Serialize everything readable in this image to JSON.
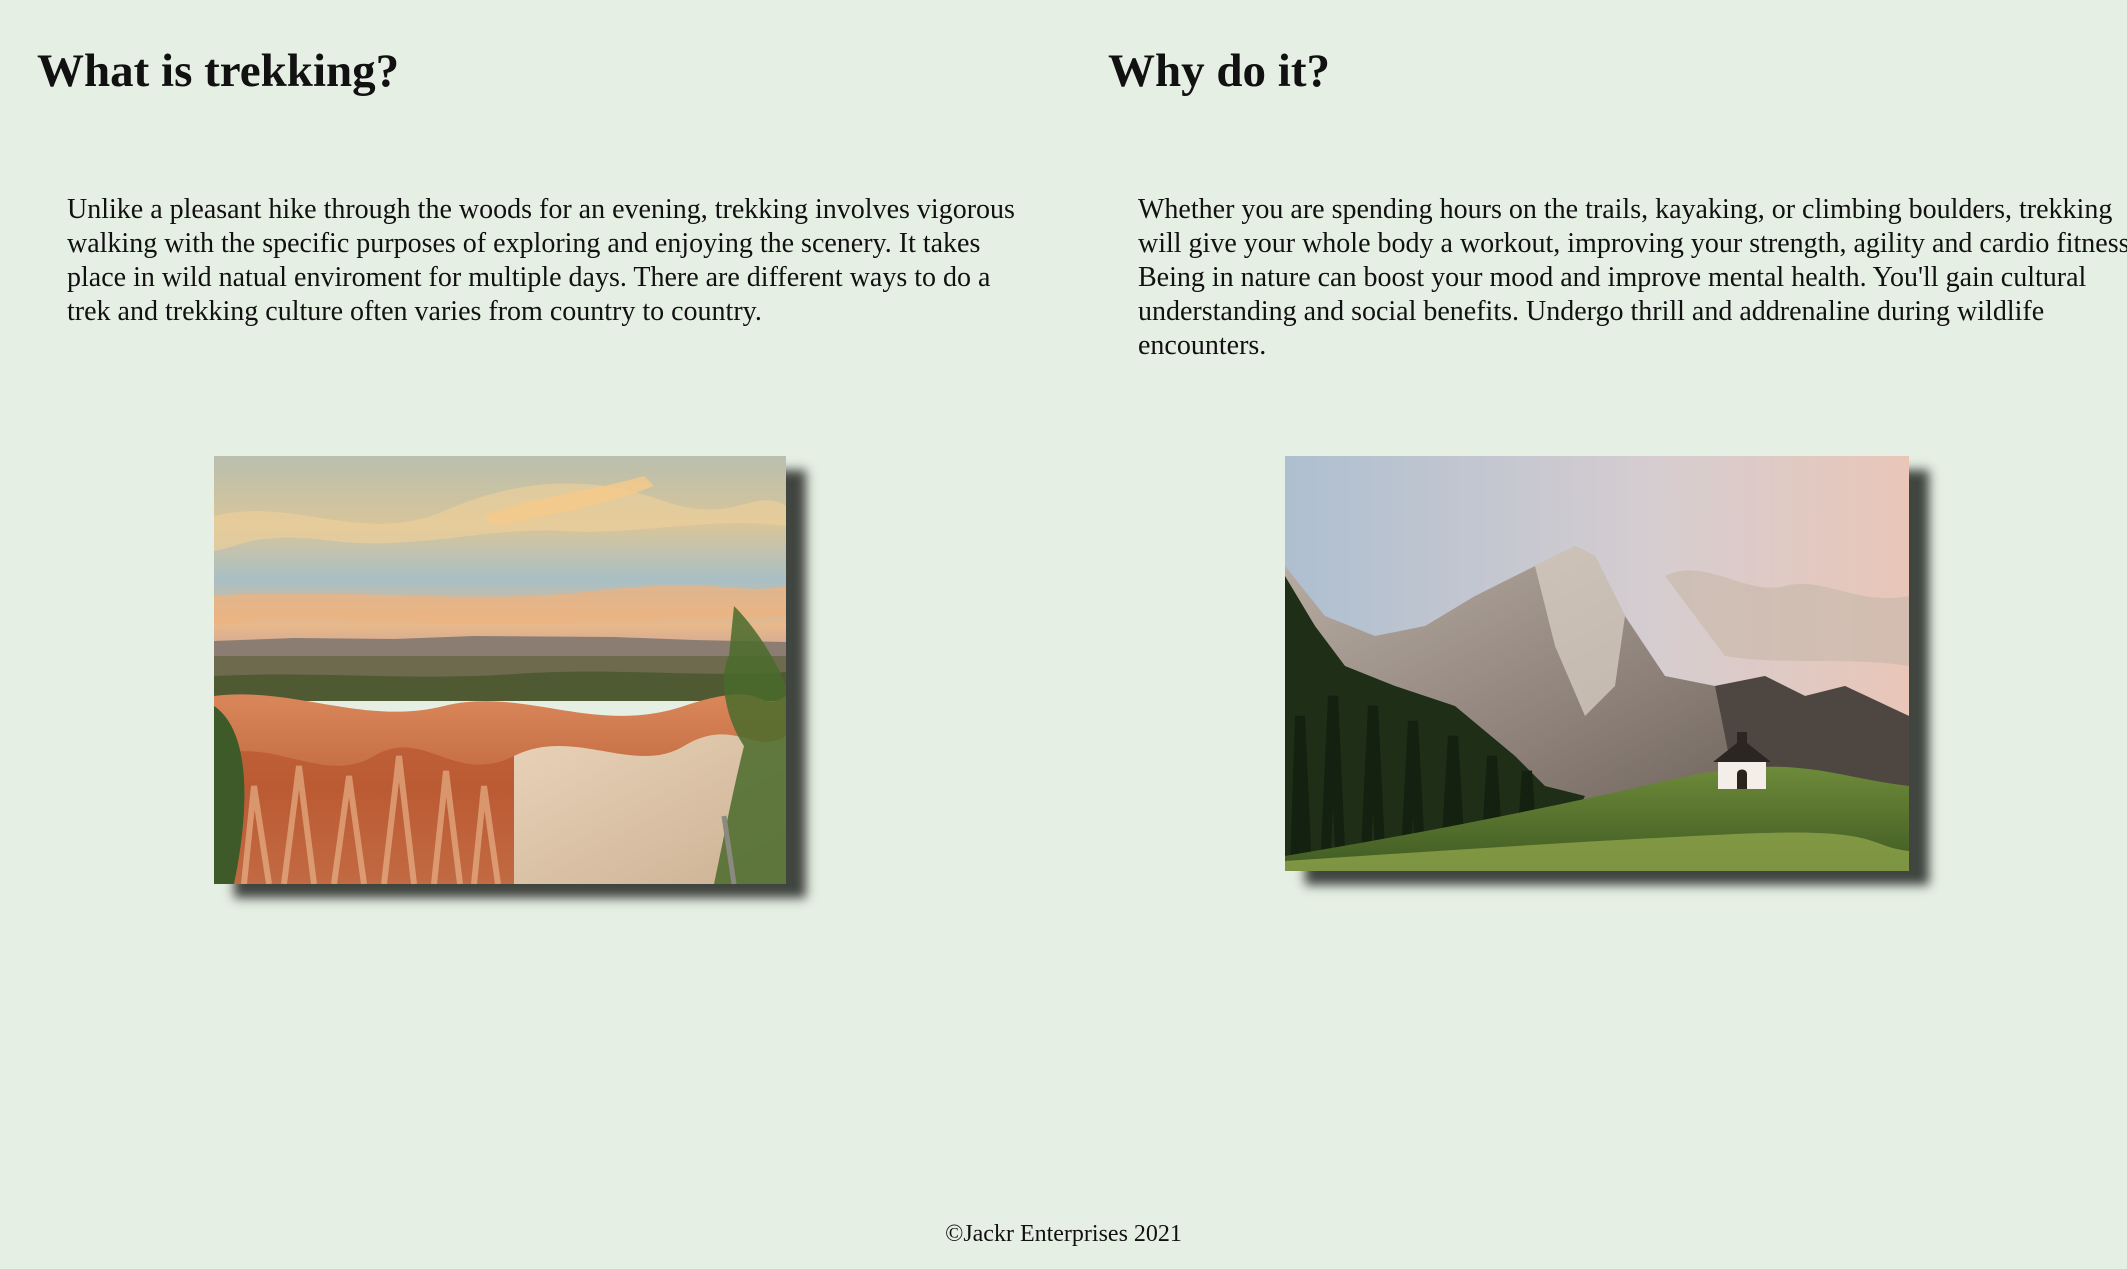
{
  "left_section": {
    "heading": "What is trekking?",
    "paragraph": "Unlike a pleasant hike through the woods for an evening, trekking involves vigorous walking with the specific purposes of exploring and enjoying the scenery. It takes place in wild natual enviroment for multiple days. There are different ways to do a trek and trekking culture often varies from country to country.",
    "image_alt": "canyon-hoodoos-sunset"
  },
  "right_section": {
    "heading": "Why do it?",
    "paragraph": "Whether you are spending hours on the trails, kayaking, or climbing boulders, trekking will give your whole body a workout, improving your strength, agility and cardio fitness. Being in nature can boost your mood and improve mental health. You'll gain cultural understanding and social benefits. Undergo thrill and addrenaline during wildlife encounters.",
    "image_alt": "alpine-peak-chapel"
  },
  "footer": {
    "text": "©Jackr Enterprises 2021"
  },
  "colors": {
    "background": "#e6efe4",
    "text": "#111111"
  }
}
